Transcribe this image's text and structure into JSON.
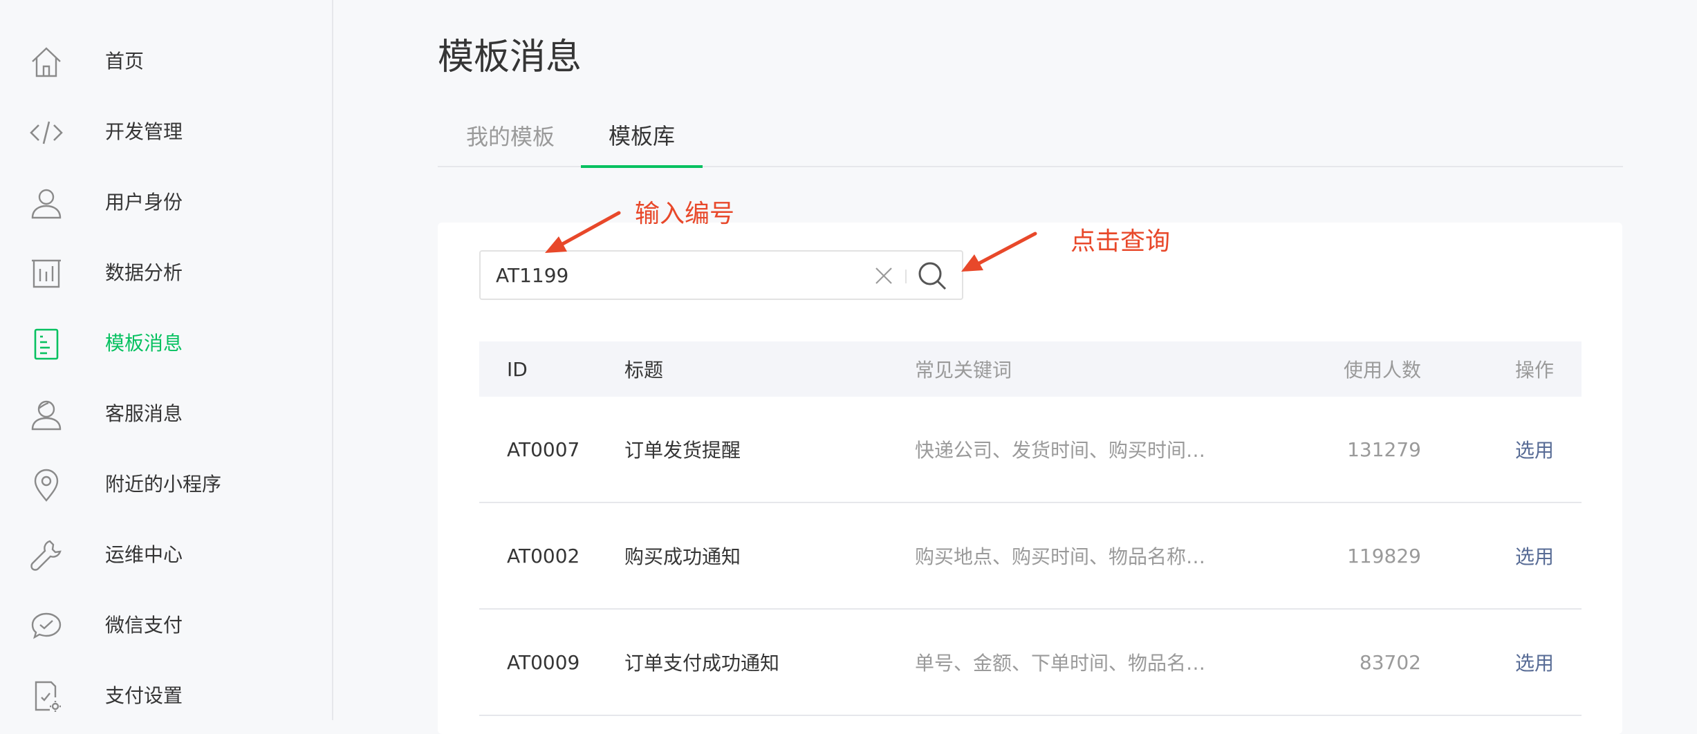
{
  "sidebar": {
    "items": [
      {
        "label": "首页",
        "icon": "home-icon"
      },
      {
        "label": "开发管理",
        "icon": "code-icon"
      },
      {
        "label": "用户身份",
        "icon": "user-icon"
      },
      {
        "label": "数据分析",
        "icon": "bar-chart-icon"
      },
      {
        "label": "模板消息",
        "icon": "document-icon"
      },
      {
        "label": "客服消息",
        "icon": "customer-service-icon"
      },
      {
        "label": "附近的小程序",
        "icon": "location-pin-icon"
      },
      {
        "label": "运维中心",
        "icon": "wrench-icon"
      },
      {
        "label": "微信支付",
        "icon": "wechat-pay-icon"
      },
      {
        "label": "支付设置",
        "icon": "payment-settings-icon"
      }
    ]
  },
  "main": {
    "title": "模板消息",
    "tabs": [
      {
        "label": "我的模板"
      },
      {
        "label": "模板库"
      }
    ],
    "search": {
      "value": "AT1199"
    },
    "annotations": {
      "input_hint": "输入编号",
      "search_hint": "点击查询"
    },
    "table": {
      "headers": {
        "id": "ID",
        "title": "标题",
        "keywords": "常见关键词",
        "users": "使用人数",
        "op": "操作"
      },
      "rows": [
        {
          "id": "AT0007",
          "title": "订单发货提醒",
          "keywords": "快递公司、发货时间、购买时间…",
          "users": "131279",
          "op": "选用"
        },
        {
          "id": "AT0002",
          "title": "购买成功通知",
          "keywords": "购买地点、购买时间、物品名称…",
          "users": "119829",
          "op": "选用"
        },
        {
          "id": "AT0009",
          "title": "订单支付成功通知",
          "keywords": "单号、金额、下单时间、物品名…",
          "users": "83702",
          "op": "选用"
        }
      ]
    }
  },
  "colors": {
    "accent": "#07c160",
    "annotation": "#e8482a",
    "link": "#576b95"
  }
}
